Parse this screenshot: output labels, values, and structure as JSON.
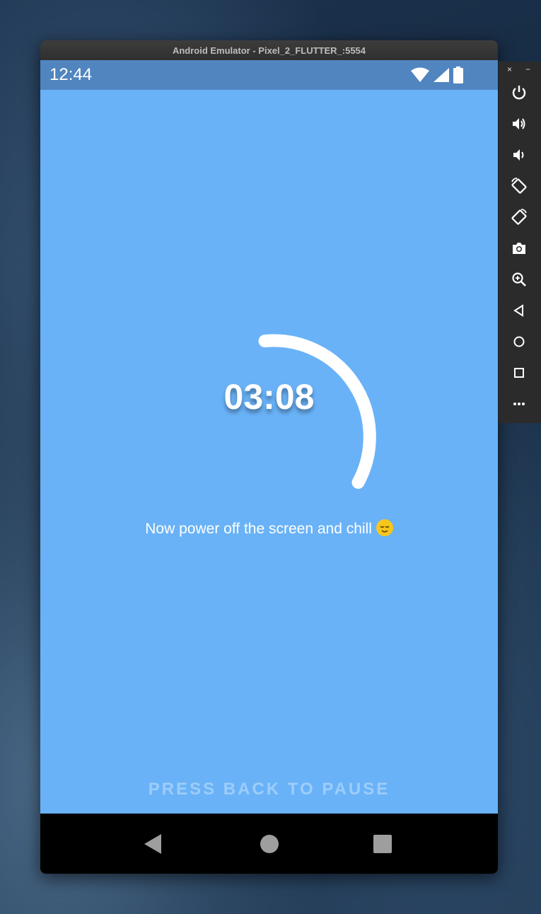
{
  "window": {
    "title": "Android Emulator - Pixel_2_FLUTTER_:5554"
  },
  "status_bar": {
    "time": "12:44",
    "icons": [
      "wifi-icon",
      "cell-signal-icon",
      "battery-icon"
    ]
  },
  "app": {
    "timer": "03:08",
    "message": "Now power off the screen and chill",
    "message_emoji": "relieved-face-emoji",
    "footer": "PRESS BACK TO PAUSE",
    "background_color": "#69b2f7",
    "status_bar_color": "#5085bf"
  },
  "navigation": [
    "back-icon",
    "home-icon",
    "recents-icon"
  ],
  "emulator_toolbar": {
    "window_controls": [
      "×",
      "−"
    ],
    "tools": [
      "power-icon",
      "volume-up-icon",
      "volume-down-icon",
      "rotate-left-icon",
      "rotate-right-icon",
      "camera-icon",
      "zoom-icon",
      "back-icon",
      "home-icon",
      "overview-icon",
      "more-icon"
    ]
  }
}
